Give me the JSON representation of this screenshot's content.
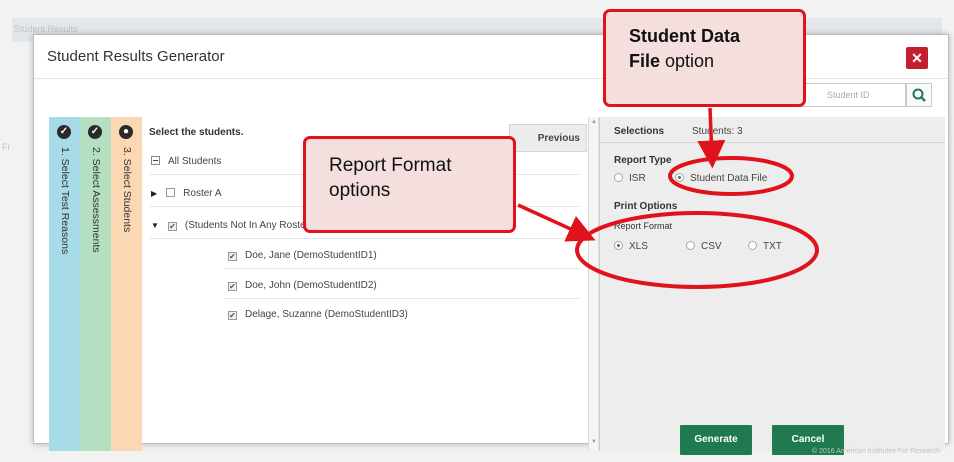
{
  "background": {
    "top_left_text": "Student Results",
    "side_text": "Fi",
    "footer_copyright": "© 2016 American Institutes For Research"
  },
  "modal": {
    "title": "Student Results Generator",
    "close_glyph": "✕",
    "search_placeholder": "Student ID"
  },
  "steps": [
    {
      "number": "✓",
      "label": "1. Select Test Reasons",
      "color": "#a8dbe8"
    },
    {
      "number": "✓",
      "label": "2. Select Assessments",
      "color": "#b4dfc1"
    },
    {
      "number": "●",
      "label": "3. Select Students",
      "color": "#fbd8b3"
    }
  ],
  "center": {
    "title": "Select the students.",
    "previous_label": "Previous",
    "all_students": "All Students",
    "roster_a": "Roster A",
    "group_label": "(Students Not In Any Roster)",
    "students": [
      "Doe, Jane (DemoStudentID1)",
      "Doe, John (DemoStudentID2)",
      "Delage, Suzanne (DemoStudentID3)"
    ]
  },
  "selections": {
    "title": "Selections",
    "students_label": "Students: 3",
    "report_type_title": "Report Type",
    "report_types": [
      "ISR",
      "Student Data File"
    ],
    "report_type_selected": "Student Data File",
    "print_options_title": "Print Options",
    "report_format_title": "Report Format",
    "formats": [
      "XLS",
      "CSV",
      "TXT"
    ],
    "format_selected": "XLS",
    "generate_label": "Generate",
    "cancel_label": "Cancel"
  },
  "callouts": {
    "student_data_file_bold": "Student Data",
    "student_data_file_bold2": "File",
    "student_data_file_rest": " option",
    "report_format_line1": "Report Format",
    "report_format_line2": "options"
  },
  "colors": {
    "accent_green": "#1f7a4f",
    "close_red": "#c21f2f",
    "callout_red": "#e0131c",
    "callout_fill": "#f4dede"
  }
}
